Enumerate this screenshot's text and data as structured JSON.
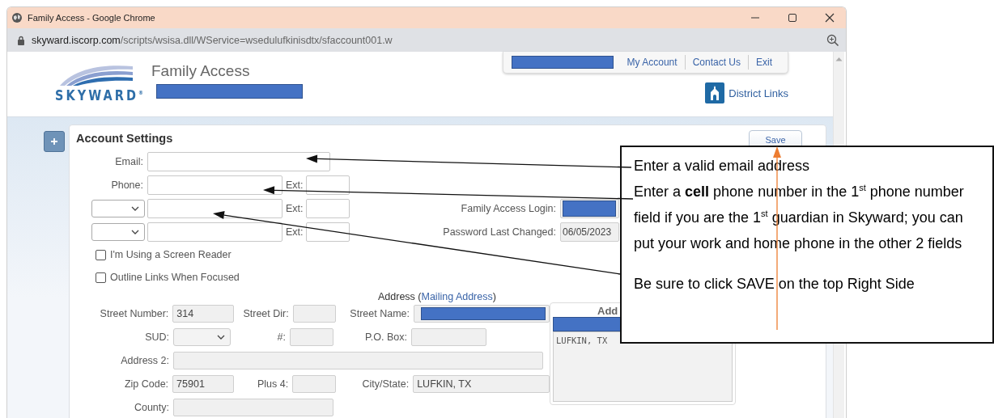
{
  "window": {
    "title": "Family Access - Google Chrome"
  },
  "address_bar": {
    "domain": "skyward.iscorp.com",
    "path": "/scripts/wsisa.dll/WService=wsedulufkinisdtx/sfaccount001.w"
  },
  "header": {
    "logo_text": "SKYWARD$^{®}$",
    "app_title": "Family Access",
    "user_redacted": true,
    "nav": [
      {
        "kind": "redacted"
      },
      {
        "kind": "link",
        "label": "My Account"
      },
      {
        "kind": "link",
        "label": "Contact Us"
      },
      {
        "kind": "link",
        "label": "Exit"
      }
    ],
    "district_links": "District Links"
  },
  "account_settings": {
    "title": "Account Settings",
    "save_button": "Save",
    "contact_rows": [
      {
        "kind": "labeled",
        "label": "Email:"
      },
      {
        "kind": "labeled",
        "label": "Phone:",
        "ext_label": "Ext:"
      },
      {
        "kind": "select",
        "ext_label": "Ext:"
      },
      {
        "kind": "select",
        "ext_label": "Ext:"
      }
    ],
    "login_fields": [
      {
        "label": "Family Access Login:",
        "redacted": true
      },
      {
        "label": "Password Last Changed:",
        "value": "06/05/2023"
      }
    ],
    "options": [
      {
        "label": "I'm Using a Screen Reader",
        "checked": false
      },
      {
        "label": "Outline Links When Focused",
        "checked": false
      }
    ]
  },
  "address": {
    "heading_before": "Address (",
    "link": "Mailing Address",
    "heading_after": ")",
    "rows": [
      [
        {
          "label": "Street Number:",
          "kind": "text",
          "value": "314"
        },
        {
          "label": "Street Dir:",
          "kind": "text"
        },
        {
          "label": "Street Name:",
          "kind": "text",
          "redacted": true
        }
      ],
      [
        {
          "label": "SUD:",
          "kind": "select"
        },
        {
          "label": "#:",
          "kind": "text"
        },
        {
          "label": "P.O. Box:",
          "kind": "text"
        }
      ],
      [
        {
          "label": "Address 2:",
          "kind": "text"
        }
      ],
      [
        {
          "label": "Zip Code:",
          "kind": "text",
          "value": "75901"
        },
        {
          "label": "Plus 4:",
          "kind": "text"
        },
        {
          "label": "City/State:",
          "kind": "text",
          "value": "LUFKIN, TX"
        }
      ],
      [
        {
          "label": "County:",
          "kind": "text"
        }
      ]
    ],
    "panel": {
      "heading": "Add",
      "redacted": true,
      "text": "LUFKIN, TX"
    }
  },
  "callout": {
    "paragraphs": [
      "Enter a valid email address",
      "Enter a **cell** phone number in the 1$^{st}$ phone number field if you are the 1$^{st}$ guardian in Skyward; you can put your work and home phone in the other 2 fields",
      "Be sure to click SAVE on the top Right Side"
    ]
  }
}
